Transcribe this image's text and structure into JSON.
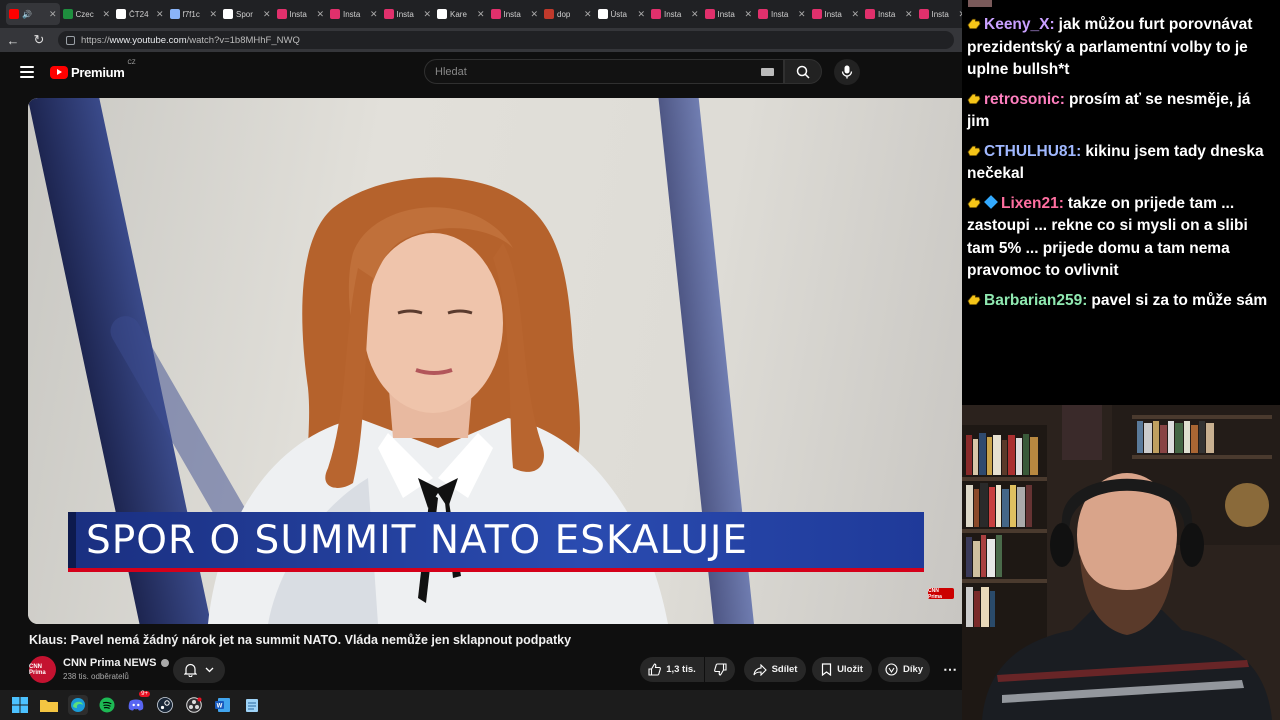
{
  "browser": {
    "tabs": [
      {
        "title": "",
        "color": "#ff0000",
        "icon": "youtube-icon",
        "active": true
      },
      {
        "title": "Czec",
        "color": "#1e8e3e",
        "icon": "sheets-icon"
      },
      {
        "title": "ČT24",
        "color": "#ffffff",
        "icon": "ct24-icon"
      },
      {
        "title": "f7f1c",
        "color": "#8ab4f8",
        "icon": "globe-icon"
      },
      {
        "title": "Spor",
        "color": "#ffffff",
        "icon": "szj-icon"
      },
      {
        "title": "Insta",
        "color": "#e1306c",
        "icon": "instagram-icon"
      },
      {
        "title": "Insta",
        "color": "#e1306c",
        "icon": "instagram-icon"
      },
      {
        "title": "Insta",
        "color": "#e1306c",
        "icon": "instagram-icon"
      },
      {
        "title": "Kare",
        "color": "#ffffff",
        "icon": "x-icon"
      },
      {
        "title": "Insta",
        "color": "#e1306c",
        "icon": "instagram-icon"
      },
      {
        "title": "dop",
        "color": "#c0392b",
        "icon": "crest-icon"
      },
      {
        "title": "Ústa",
        "color": "#ffffff",
        "icon": "doc-icon"
      },
      {
        "title": "Insta",
        "color": "#e1306c",
        "icon": "instagram-icon"
      },
      {
        "title": "Insta",
        "color": "#e1306c",
        "icon": "instagram-icon"
      },
      {
        "title": "Insta",
        "color": "#e1306c",
        "icon": "instagram-icon"
      },
      {
        "title": "Insta",
        "color": "#e1306c",
        "icon": "instagram-icon"
      },
      {
        "title": "Insta",
        "color": "#e1306c",
        "icon": "instagram-icon"
      },
      {
        "title": "Insta",
        "color": "#e1306c",
        "icon": "instagram-icon"
      }
    ],
    "url_prefix": "https://",
    "url_domain": "www.youtube.com",
    "url_path": "/watch?v=1b8MHhF_NWQ"
  },
  "youtube": {
    "logo_text": "Premium",
    "logo_country": "CZ",
    "search_placeholder": "Hledat",
    "video": {
      "lower_third": "SPOR O SUMMIT NATO ESKALUJE",
      "bug": "CNN Prima"
    },
    "title": "Klaus: Pavel nemá žádný nárok jet na summit NATO. Vláda nemůže jen sklapnout podpatky",
    "channel": {
      "name": "CNN Prima NEWS",
      "avatar_text": "CNN Prima",
      "subscribers": "238 tis. odběratelů"
    },
    "actions": {
      "likes": "1,3 tis.",
      "share": "Sdílet",
      "save": "Uložit",
      "thanks": "Díky",
      "more": "⋯"
    }
  },
  "chat": {
    "messages": [
      {
        "user": "Keeny_X:",
        "color": "#c9a0ff",
        "text": "jak můžou furt porovnávat prezidentský a parlamentní volby to je uplne bullsh*t",
        "badges": [
          "hand"
        ]
      },
      {
        "user": "retrosonic:",
        "color": "#ff7fbf",
        "text": "prosím ať se nesměje, já jim",
        "badges": [
          "hand"
        ]
      },
      {
        "user": "CTHULHU81:",
        "color": "#a0b8ff",
        "text": "kikinu jsem tady dneska nečekal",
        "badges": [
          "hand"
        ]
      },
      {
        "user": "Lixen21:",
        "color": "#ff6fa0",
        "text": "takze on prijede tam ... zastoupi ... rekne co si mysli on a slibi tam 5% ... prijede domu a tam nema pravomoc to ovlivnit",
        "badges": [
          "hand",
          "gem"
        ]
      },
      {
        "user": "Barbarian259:",
        "color": "#8fe8b0",
        "text": "pavel si za to může sám",
        "badges": [
          "hand"
        ]
      }
    ]
  },
  "taskbar": {
    "icons": [
      "windows-start-icon",
      "file-explorer-icon",
      "edge-icon",
      "spotify-icon",
      "discord-icon",
      "steam-icon",
      "obs-icon",
      "word-icon",
      "notepad-icon"
    ],
    "discord_badge": "9+"
  }
}
